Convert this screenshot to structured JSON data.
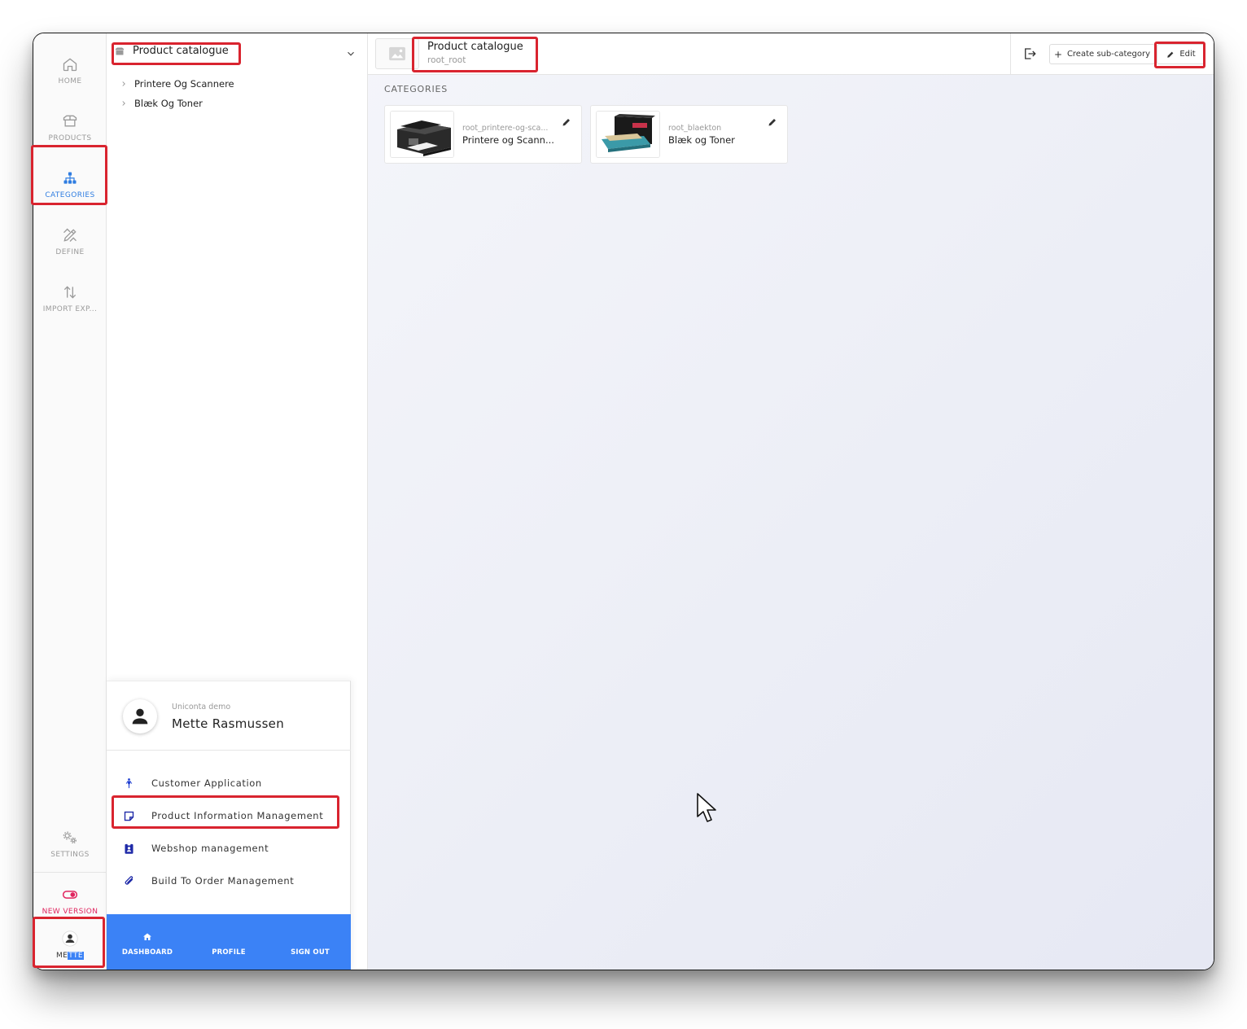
{
  "rail": {
    "items": [
      {
        "label": "HOME",
        "icon": "home-icon"
      },
      {
        "label": "PRODUCTS",
        "icon": "box-icon"
      },
      {
        "label": "CATEGORIES",
        "icon": "hierarchy-icon",
        "active": true
      },
      {
        "label": "DEFINE",
        "icon": "pencil-ruler-icon"
      },
      {
        "label": "IMPORT EXP...",
        "icon": "sort-arrows-icon"
      }
    ],
    "settings_label": "SETTINGS",
    "new_version_label": "NEW VERSION",
    "user_label_plain": "ME",
    "user_label_highlight": "TTE"
  },
  "tree": {
    "title": "Product catalogue",
    "nodes": [
      {
        "label": "Printere Og Scannere"
      },
      {
        "label": "Blæk Og Toner"
      }
    ]
  },
  "popup": {
    "org": "Uniconta demo",
    "name": "Mette Rasmussen",
    "apps": [
      {
        "label": "Customer Application",
        "icon": "person-icon"
      },
      {
        "label": "Product Information Management",
        "icon": "note-icon"
      },
      {
        "label": "Webshop management",
        "icon": "badge-icon"
      },
      {
        "label": "Build To Order Management",
        "icon": "paperclip-icon"
      }
    ],
    "footer": {
      "dashboard": "DASHBOARD",
      "profile": "PROFILE",
      "sign_out": "SIGN OUT"
    }
  },
  "header": {
    "title": "Product catalogue",
    "code": "root_root",
    "create_label": "Create sub-category",
    "edit_label": "Edit"
  },
  "main": {
    "section_title": "CATEGORIES",
    "cards": [
      {
        "code": "root_printere-og-sca...",
        "name": "Printere og Scann..."
      },
      {
        "code": "root_blaekton",
        "name": "Blæk og Toner"
      }
    ]
  },
  "colors": {
    "accent": "#3b82f6",
    "active_nav": "#2f7de1",
    "annotation": "#d9242f",
    "new_version": "#e0245e"
  }
}
